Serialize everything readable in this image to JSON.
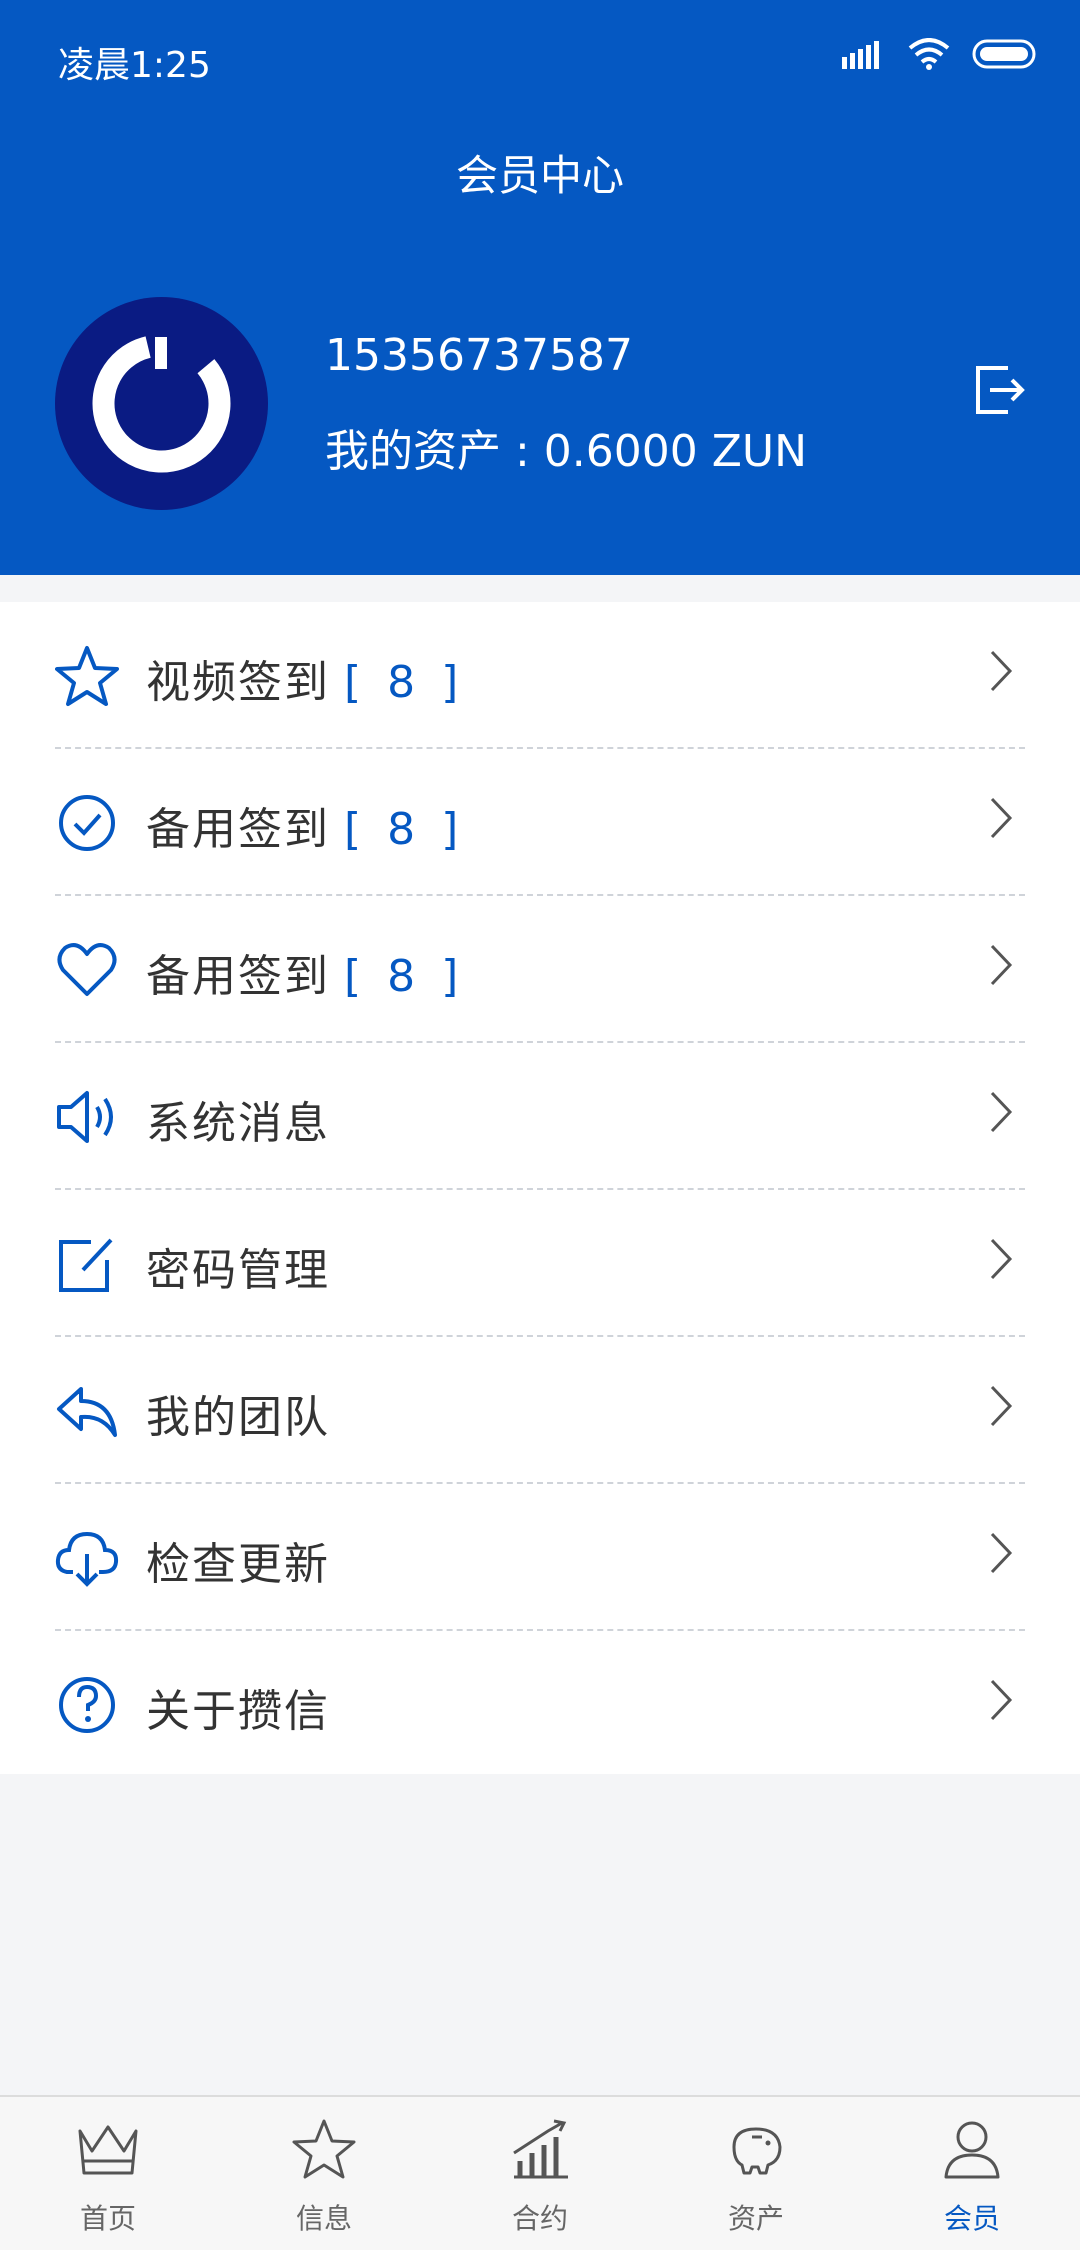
{
  "status_bar": {
    "time": "凌晨1:25"
  },
  "header": {
    "title": "会员中心",
    "phone": "15356737587",
    "assets": "我的资产 : 0.6000 ZUN"
  },
  "menu": [
    {
      "label": "视频签到",
      "count": "[ 8 ]",
      "icon": "star-icon"
    },
    {
      "label": "备用签到",
      "count": "[ 8 ]",
      "icon": "check-circle-icon"
    },
    {
      "label": "备用签到",
      "count": "[ 8 ]",
      "icon": "heart-icon"
    },
    {
      "label": "系统消息",
      "count": "",
      "icon": "speaker-icon"
    },
    {
      "label": "密码管理",
      "count": "",
      "icon": "edit-icon"
    },
    {
      "label": "我的团队",
      "count": "",
      "icon": "reply-icon"
    },
    {
      "label": "检查更新",
      "count": "",
      "icon": "cloud-download-icon"
    },
    {
      "label": "关于攒信",
      "count": "",
      "icon": "help-circle-icon"
    }
  ],
  "tabbar": [
    {
      "label": "首页",
      "icon": "crown-icon"
    },
    {
      "label": "信息",
      "icon": "star-outline-icon"
    },
    {
      "label": "合约",
      "icon": "chart-icon"
    },
    {
      "label": "资产",
      "icon": "piggy-bank-icon"
    },
    {
      "label": "会员",
      "icon": "user-icon",
      "active": true
    }
  ],
  "colors": {
    "brand": "#0558c2",
    "avatar_bg": "#0a1b83",
    "active_tab": "#0558c2"
  }
}
